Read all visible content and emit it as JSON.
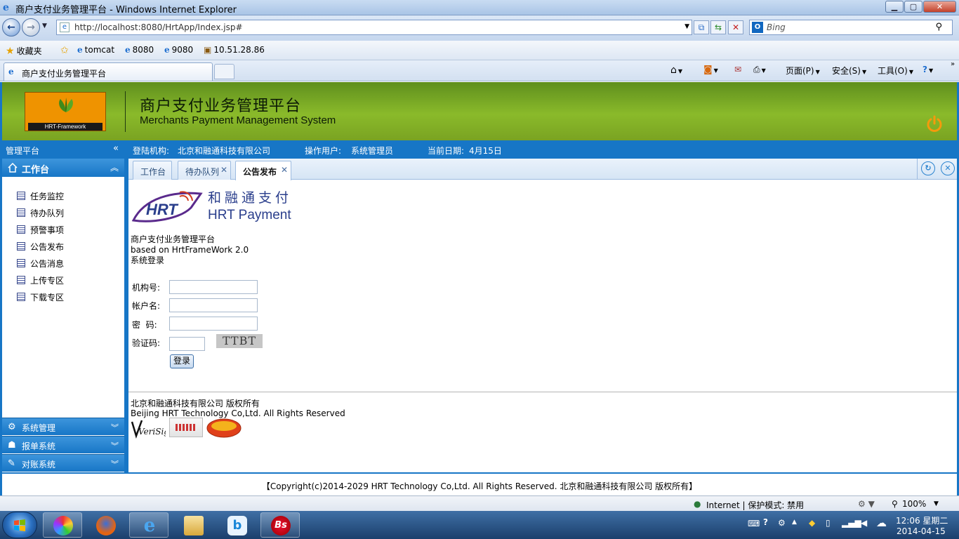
{
  "window": {
    "title": "商户支付业务管理平台 - Windows Internet Explorer",
    "minimize": "▁",
    "maximize": "▢",
    "close": "✕"
  },
  "addressbar": {
    "url": "http://localhost:8080/HrtApp/Index.jsp#",
    "search_placeholder": "Bing"
  },
  "favorites": {
    "label": "收藏夹",
    "links": [
      "tomcat",
      "8080",
      "9080",
      "10.51.28.86"
    ]
  },
  "ie_tab": {
    "title": "商户支付业务管理平台"
  },
  "commandbar": {
    "page": "页面(P)",
    "safety": "安全(S)",
    "tools": "工具(O)"
  },
  "app": {
    "logo_text": "HRT-Framework",
    "title_cn": "商户支付业务管理平台",
    "title_en": "Merchants Payment Management System"
  },
  "infobar": {
    "org_label": "登陆机构:",
    "org_value": "北京和融通科技有限公司",
    "user_label": "操作用户:",
    "user_value": "系统管理员",
    "date_label": "当前日期:",
    "date_value": "4月15日"
  },
  "sidebar": {
    "header": "管理平台",
    "group": "工作台",
    "items": [
      {
        "label": "任务监控"
      },
      {
        "label": "待办队列"
      },
      {
        "label": "预警事项"
      },
      {
        "label": "公告发布"
      },
      {
        "label": "公告消息"
      },
      {
        "label": "上传专区"
      },
      {
        "label": "下载专区"
      }
    ],
    "bottom_groups": [
      {
        "label": "系统管理"
      },
      {
        "label": "报单系统"
      },
      {
        "label": "对账系统"
      }
    ]
  },
  "tabs": [
    {
      "label": "工作台",
      "closable": false
    },
    {
      "label": "待办队列",
      "closable": true
    },
    {
      "label": "公告发布",
      "closable": true,
      "active": true
    }
  ],
  "login": {
    "brand_cn": "和融通支付",
    "brand_en": "HRT Payment",
    "logo_text": "HRT",
    "system_name": "商户支付业务管理平台",
    "based_on": "based on HrtFrameWork 2.0",
    "section": "系统登录",
    "org_label": "机构号:",
    "account_label": "帐户名:",
    "password_label": "密  码:",
    "captcha_label": "验证码:",
    "captcha_text": "TTBT",
    "login_button": "登录",
    "org_value": "",
    "account_value": "",
    "password_value": "",
    "captcha_value": ""
  },
  "footer": {
    "company_cn": "北京和融通科技有限公司  版权所有",
    "company_en": "Beijing HRT Technology Co,Ltd. All Rights Reserved",
    "verisign": "VeriSign",
    "copyright": "【Copyright(c)2014-2029 HRT Technology Co,Ltd. All Rights Reserved. 北京和融通科技有限公司  版权所有】"
  },
  "statusbar": {
    "zone": "Internet | 保护模式: 禁用",
    "zoom": "100%"
  },
  "taskbar": {
    "time": "12:06 星期二",
    "date": "2014-04-15"
  },
  "colors": {
    "accent": "#1776c6",
    "banner": "#7aa322",
    "logo": "#ef9300"
  }
}
